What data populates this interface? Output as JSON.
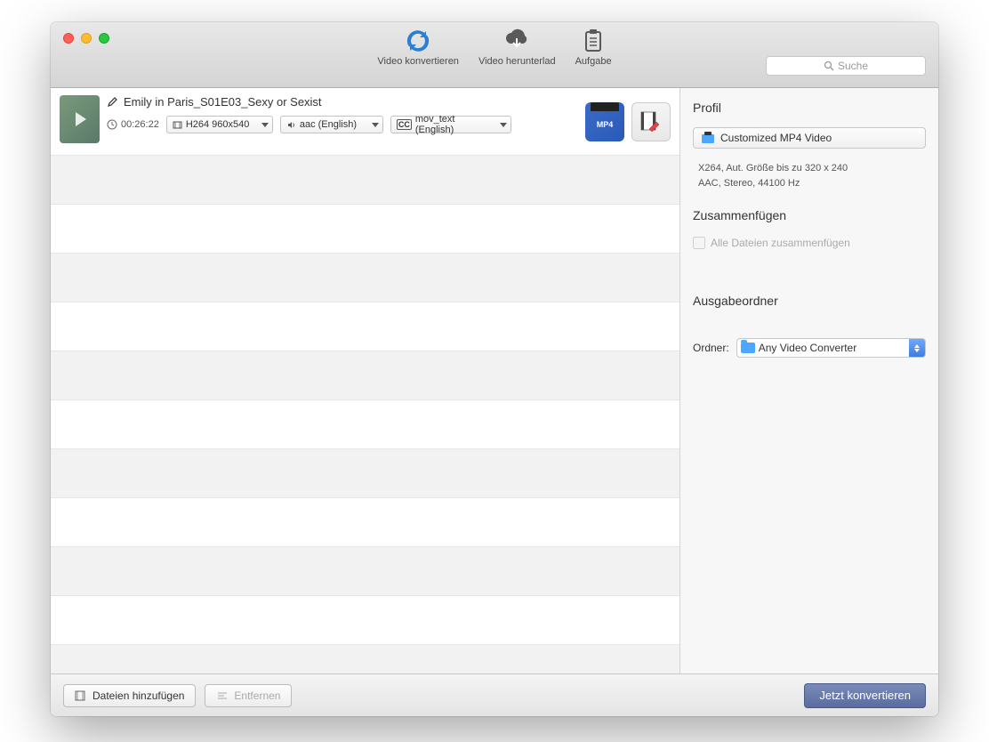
{
  "toolbar": {
    "convert_label": "Video konvertieren",
    "download_label": "Video herunterlad",
    "task_label": "Aufgabe"
  },
  "search": {
    "placeholder": "Suche"
  },
  "file": {
    "title": "Emily in Paris_S01E03_Sexy or Sexist",
    "duration": "00:26:22",
    "video_codec": "H264 960x540",
    "audio_codec": "aac (English)",
    "subtitle": "mov_text (English)",
    "cc_label": "CC",
    "mp4_badge": "MP4"
  },
  "sidebar": {
    "profile_heading": "Profil",
    "profile_name": "Customized MP4 Video",
    "profile_line1": "X264, Aut. Größe bis zu 320 x 240",
    "profile_line2": "AAC, Stereo, 44100 Hz",
    "merge_heading": "Zusammenfügen",
    "merge_label": "Alle Dateien zusammenfügen",
    "output_heading": "Ausgabeordner",
    "folder_label": "Ordner:",
    "folder_value": "Any Video Converter"
  },
  "footer": {
    "add_label": "Dateien hinzufügen",
    "remove_label": "Entfernen",
    "convert_label": "Jetzt konvertieren"
  }
}
